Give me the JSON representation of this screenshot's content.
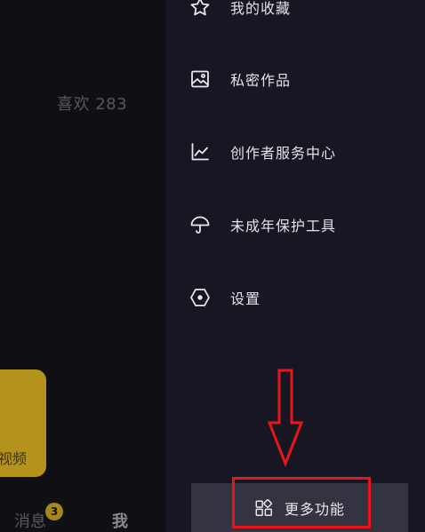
{
  "profile": {
    "likes_label": "喜欢 283",
    "card_text": "视频"
  },
  "tabs": {
    "messages_label": "消息",
    "messages_badge": "3",
    "me_label": "我"
  },
  "drawer": {
    "items": [
      {
        "label": "我的收藏",
        "icon": "star-icon"
      },
      {
        "label": "私密作品",
        "icon": "image-icon"
      },
      {
        "label": "创作者服务中心",
        "icon": "chart-icon"
      },
      {
        "label": "未成年保护工具",
        "icon": "umbrella-icon"
      },
      {
        "label": "设置",
        "icon": "hexagon-settings-icon"
      }
    ],
    "more_label": "更多功能",
    "more_icon": "grid-icon"
  },
  "annotation": {
    "highlight_color": "#e8161c"
  }
}
